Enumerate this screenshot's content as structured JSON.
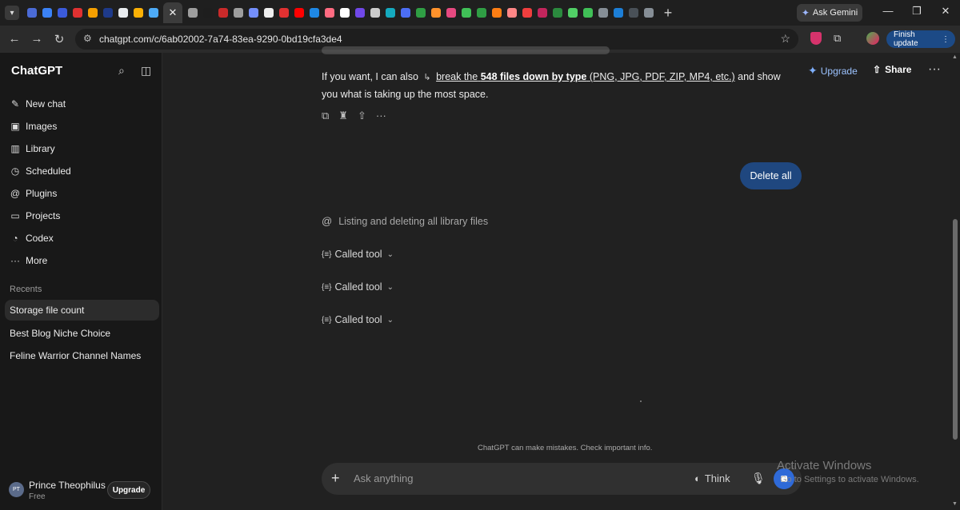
{
  "browser": {
    "active_tab_close": "✕",
    "new_tab": "+",
    "ask_gemini": "Ask Gemini",
    "url": "chatgpt.com/c/6ab02002-7a74-83ea-9290-0bd19cfa3de4",
    "finish_update": "Finish update",
    "window_controls": {
      "minimize": "—",
      "restore": "❐",
      "close": "✕"
    },
    "favicon_colors": [
      "#4b6bd6",
      "#3b82f6",
      "#3b5bdb",
      "#e03131",
      "#f59f00",
      "#1e3a8a",
      "#e9ecef",
      "#fab005",
      "#4dabf7",
      "#9e9e9e",
      "#1e1e1e",
      "#c92a2a",
      "#9e9e9e",
      "#748ffc",
      "#eeeeee",
      "#e03131",
      "#ff0000",
      "#1e88e5",
      "#ff6b81",
      "#ffffff",
      "#7048e8",
      "#cccccc",
      "#15aabf",
      "#4c6ef5",
      "#2f9e44",
      "#ff922b",
      "#e64980",
      "#40c057",
      "#2f9e44",
      "#fd7e14",
      "#ff8787",
      "#f03e3e",
      "#c2255c",
      "#2b8a3e",
      "#51cf66",
      "#40c057",
      "#868e96",
      "#1c7ed6",
      "#495057",
      "#868e96"
    ]
  },
  "sidebar": {
    "brand": "ChatGPT",
    "nav": [
      {
        "label": "New chat",
        "icon": "✎"
      },
      {
        "label": "Images",
        "icon": "▣"
      },
      {
        "label": "Library",
        "icon": "▥"
      },
      {
        "label": "Scheduled",
        "icon": "◷"
      },
      {
        "label": "Plugins",
        "icon": "@"
      },
      {
        "label": "Projects",
        "icon": "▭"
      },
      {
        "label": "Codex",
        "icon": "◔"
      },
      {
        "label": "More",
        "icon": "···"
      }
    ],
    "recents_label": "Recents",
    "recents": [
      "Storage file count",
      "Best Blog Niche Choice",
      "Feline Warrior Channel Names"
    ],
    "user": {
      "initials": "PT",
      "name": "Prince Theophilus",
      "plan": "Free",
      "upgrade": "Upgrade"
    }
  },
  "topbar": {
    "upgrade": "Upgrade",
    "share": "Share"
  },
  "conversation": {
    "assistant_text_pre": "If you want, I can also",
    "assistant_link_a": "break the",
    "assistant_link_bold": "548 files down by type",
    "assistant_link_b": "(PNG, JPG, PDF, ZIP, MP4, etc.)",
    "assistant_text_post": "and show you what is taking up the most space.",
    "user_message": "Delete all",
    "status": "Listing and deleting all library files",
    "tool_calls": [
      "Called tool",
      "Called tool",
      "Called tool"
    ]
  },
  "footer": {
    "disclaimer": "ChatGPT can make mistakes. Check important info."
  },
  "composer": {
    "placeholder": "Ask anything",
    "think": "Think"
  },
  "watermark": {
    "title": "Activate Windows",
    "subtitle": "Go to Settings to activate Windows."
  }
}
